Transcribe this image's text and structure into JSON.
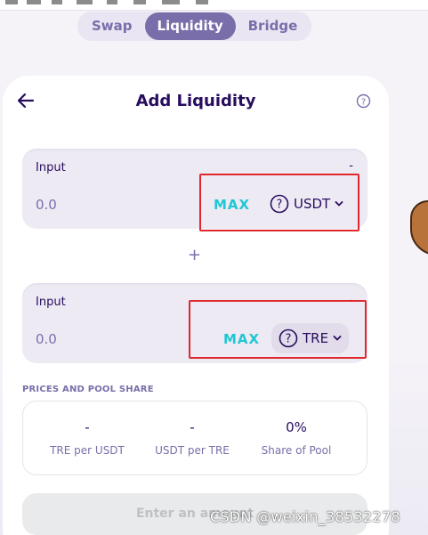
{
  "nav": {
    "tabs": [
      {
        "label": "Swap",
        "active": false
      },
      {
        "label": "Liquidity",
        "active": true
      },
      {
        "label": "Bridge",
        "active": false
      }
    ]
  },
  "card": {
    "title": "Add Liquidity",
    "input_a": {
      "label": "Input",
      "balance": "-",
      "amount_placeholder": "0.0",
      "max_label": "MAX",
      "token": "USDT"
    },
    "plus": "+",
    "input_b": {
      "label": "Input",
      "balance": "-",
      "amount_placeholder": "0.0",
      "max_label": "MAX",
      "token": "TRE"
    },
    "prices_section_label": "PRICES AND POOL SHARE",
    "prices": [
      {
        "value": "-",
        "label": "TRE per USDT"
      },
      {
        "value": "-",
        "label": "USDT per TRE"
      },
      {
        "value": "0%",
        "label": "Share of Pool"
      }
    ],
    "submit_label": "Enter an amount"
  },
  "watermark": "CSDN @weixin_38532278",
  "colors": {
    "primary_text": "#280d5f",
    "secondary_text": "#7a6eaa",
    "accent": "#1fc7d4",
    "highlight_box": "#e0272d"
  }
}
